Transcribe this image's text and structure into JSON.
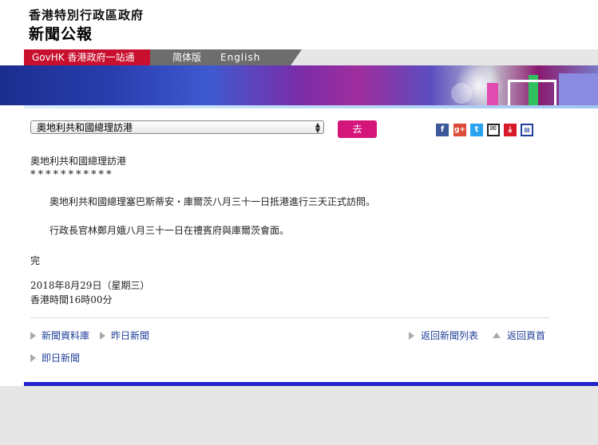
{
  "header": {
    "gov_name": "香港特別行政區政府",
    "press_title": "新聞公報"
  },
  "nav": {
    "govhk": "GovHK 香港政府一站通",
    "simplified": "简体版",
    "english": "English"
  },
  "toolbar": {
    "select_value": "奧地利共和國總理訪港",
    "go_label": "去"
  },
  "share_icons": [
    "facebook-icon",
    "google-plus-icon",
    "twitter-icon",
    "email-icon",
    "save-icon",
    "print-icon"
  ],
  "article": {
    "heading": "奧地利共和國總理訪港",
    "stars": "***********",
    "paragraphs": [
      "奧地利共和國總理塞巴斯蒂安・庫爾茨八月三十一日抵港進行三天正式訪問。",
      "行政長官林鄭月娥八月三十一日在禮賓府與庫爾茨會面。"
    ],
    "end": "完",
    "date": "2018年8月29日（星期三）",
    "time": "香港時間16時00分"
  },
  "links": {
    "news_archive": "新聞資料庫",
    "yesterday": "昨日新聞",
    "back_list": "返回新聞列表",
    "back_top": "返回頁首",
    "today": "即日新聞"
  },
  "colors": {
    "govhk_red": "#c8102e",
    "go_button": "#d4157a",
    "link_blue": "#1f3f99",
    "footer_blue": "#2222cc"
  }
}
